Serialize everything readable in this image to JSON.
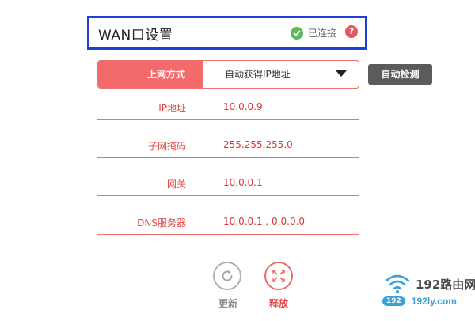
{
  "header": {
    "title": "WAN口设置",
    "status_text": "已连接",
    "help_glyph": "?",
    "status_color": "#5bb85b",
    "border_color": "#1f3fd6"
  },
  "connection": {
    "label": "上网方式",
    "selected_value": "自动获得IP地址",
    "detect_label": "自动检测",
    "accent_color": "#f26a6a"
  },
  "info_rows": [
    {
      "label": "IP地址",
      "value": "10.0.0.9"
    },
    {
      "label": "子网掩码",
      "value": "255.255.255.0"
    },
    {
      "label": "网关",
      "value": "10.0.0.1"
    },
    {
      "label": "DNS服务器",
      "value": "10.0.0.1 , 0.0.0.0"
    }
  ],
  "actions": {
    "refresh_label": "更新",
    "release_label": "释放"
  },
  "watermark": {
    "title": "192路由网",
    "badge": "192",
    "url": "192ly.com"
  },
  "icons": [
    "check-icon",
    "help-icon",
    "caret-down-icon",
    "refresh-icon",
    "release-icon",
    "wifi-icon"
  ]
}
